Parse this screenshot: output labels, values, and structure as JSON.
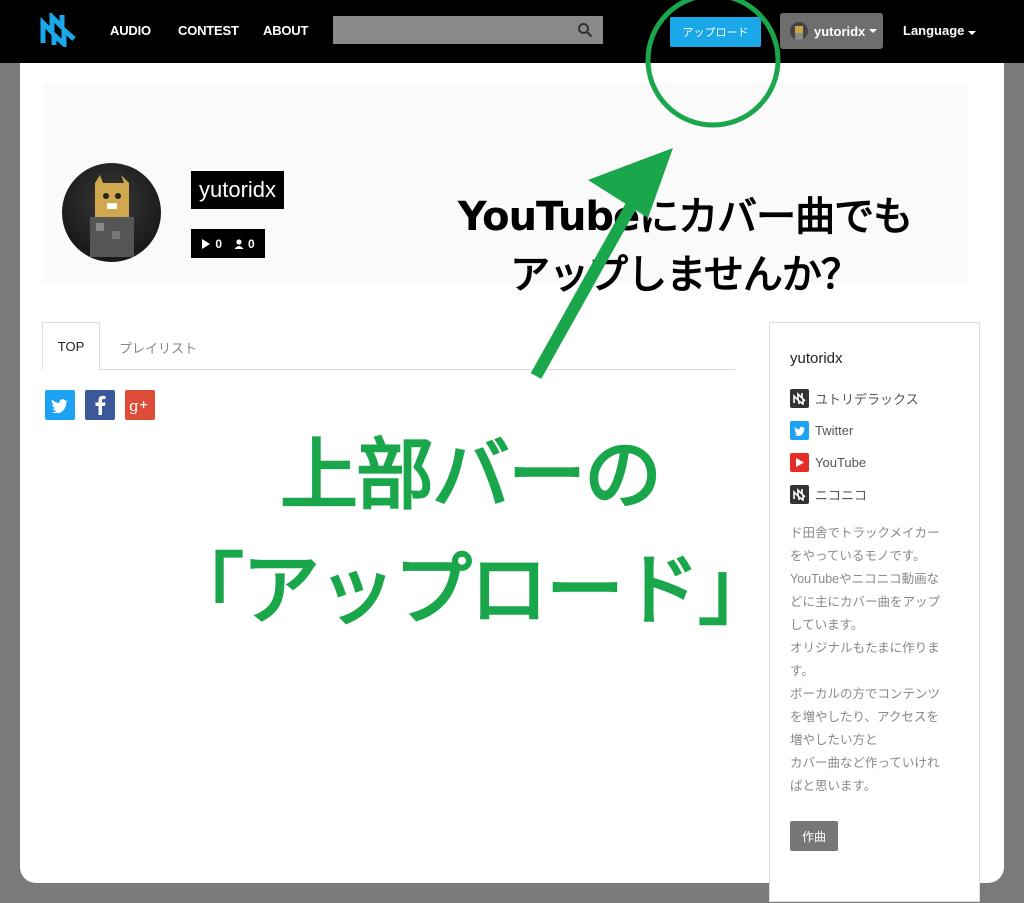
{
  "nav": {
    "links": [
      "AUDIO",
      "CONTEST",
      "ABOUT"
    ],
    "search_placeholder": "",
    "upload_label": "アップロード",
    "user_name": "yutoridx",
    "language_label": "Language"
  },
  "profile": {
    "name": "yutoridx",
    "plays": "0",
    "followers": "0"
  },
  "tabs": [
    "TOP",
    "プレイリスト"
  ],
  "share": [
    "twitter",
    "facebook",
    "google-plus"
  ],
  "sidebar": {
    "title": "yutoridx",
    "links": [
      {
        "label": "ユトリデラックス",
        "icon": "site-logo-icon",
        "color": "#333333"
      },
      {
        "label": "Twitter",
        "icon": "twitter-icon",
        "color": "#1da1f2"
      },
      {
        "label": "YouTube",
        "icon": "youtube-icon",
        "color": "#e52d27"
      },
      {
        "label": "ニコニコ",
        "icon": "niconico-icon",
        "color": "#333333"
      }
    ],
    "bio": "ド田舎でトラックメイカー\nをやっているモノです。\nYouTubeやニコニコ動画な\nどに主にカバー曲をアップ\nしています。\nオリジナルもたまに作りま\nす。\nボーカルの方でコンテンツ\nを増やしたり、アクセスを\n増やしたい方と\nカバー曲など作っていけれ\nばと思います。",
    "tag": "作曲"
  },
  "annotations": {
    "banner_line1": "YouTubeにカバー曲でも",
    "banner_line2": "アップしませんか？",
    "green_line1": "上部バーの",
    "green_line2": "「アップロード」"
  },
  "colors": {
    "accent": "#1aa8e8",
    "annotation_green": "#1aa64a",
    "twitter": "#1da1f2",
    "facebook": "#3b5998",
    "google_plus": "#dd4b39"
  }
}
